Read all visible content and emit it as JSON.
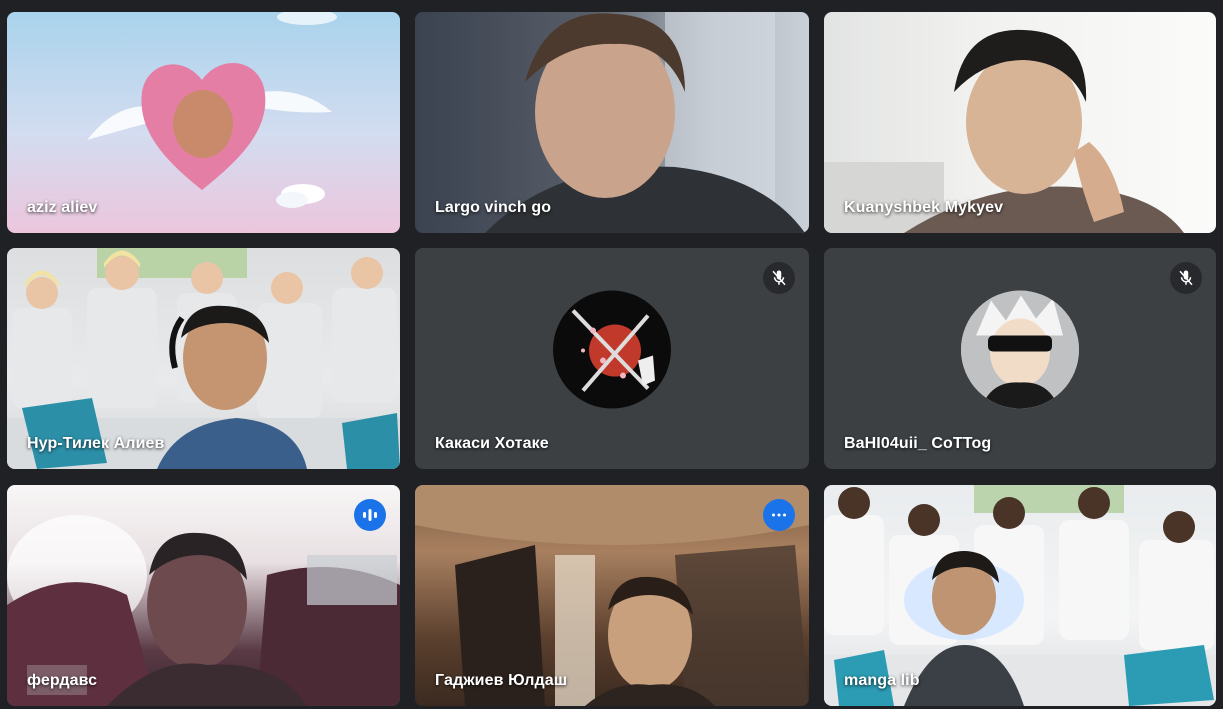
{
  "participants": [
    {
      "name": "aziz aliev",
      "status": "none"
    },
    {
      "name": "Largo vinch go",
      "status": "none"
    },
    {
      "name": "Kuanyshbek Mykyev",
      "status": "none"
    },
    {
      "name": "Нур-Тилек Алиев",
      "status": "none"
    },
    {
      "name": "Какаси Хотаке",
      "status": "muted"
    },
    {
      "name": "BaHI04uii_ CoTTog",
      "status": "muted"
    },
    {
      "name": "фердавс",
      "status": "speaking"
    },
    {
      "name": "Гаджиев Юлдаш",
      "status": "speaking"
    },
    {
      "name": "manga lib",
      "status": "none"
    }
  ],
  "icons": {
    "muted": "mic-off-icon",
    "speaking": "audio-level-icon"
  },
  "colors": {
    "background": "#202124",
    "tile": "#3c4043",
    "active_border": "#8ab4f8",
    "speaking_badge": "#1a73e8"
  }
}
